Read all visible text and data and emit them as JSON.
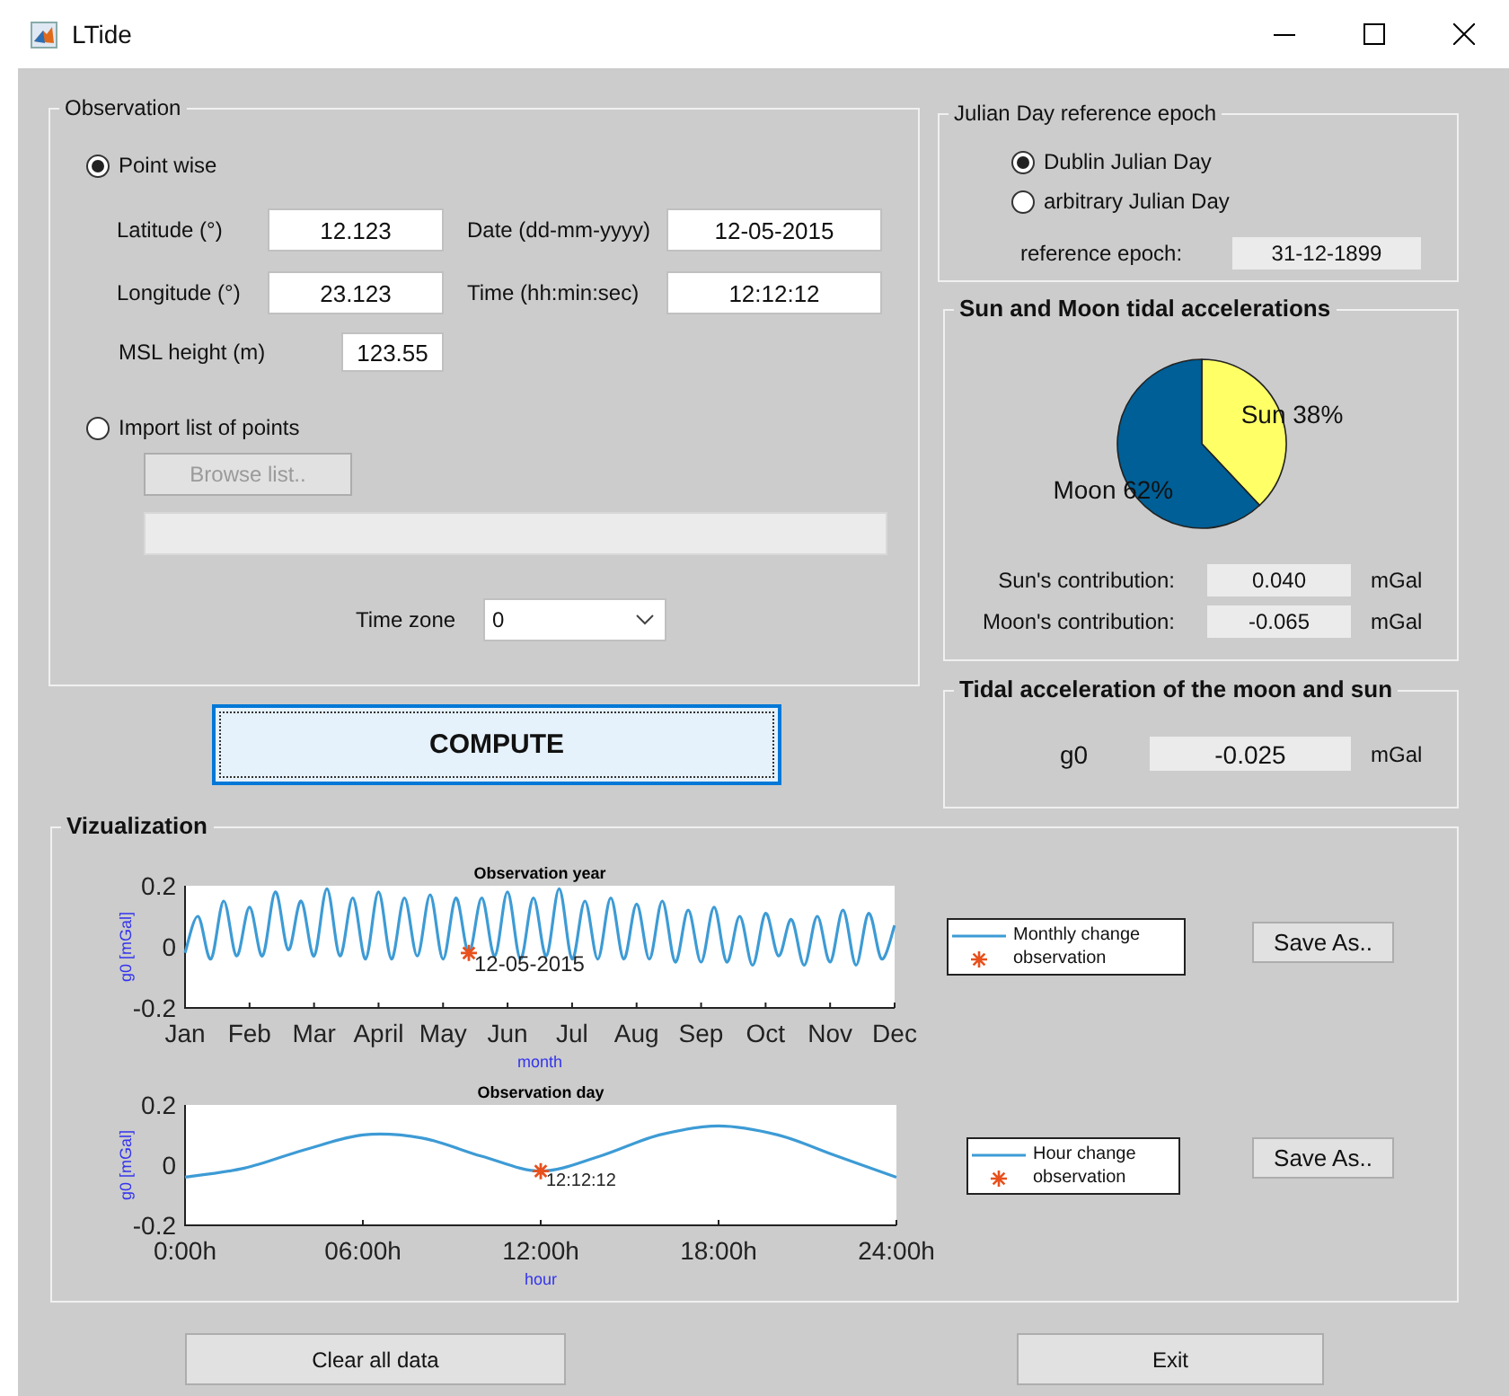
{
  "window": {
    "title": "LTide"
  },
  "observation": {
    "title": "Observation",
    "modes": [
      {
        "label": "Point wise",
        "selected": true
      },
      {
        "label": "Import list of points",
        "selected": false
      }
    ],
    "latitude": {
      "label": "Latitude (°)",
      "value": "12.123"
    },
    "date": {
      "label": "Date (dd-mm-yyyy)",
      "value": "12-05-2015"
    },
    "longitude": {
      "label": "Longitude (°)",
      "value": "23.123"
    },
    "time": {
      "label": "Time (hh:min:sec)",
      "value": "12:12:12"
    },
    "msl_height": {
      "label": "MSL height (m)",
      "value": "123.55"
    },
    "browse_button": {
      "label": "Browse list..",
      "disabled": true
    },
    "time_zone": {
      "label": "Time zone",
      "value": "0"
    }
  },
  "compute_button": {
    "label": "COMPUTE"
  },
  "julian": {
    "title": "Julian Day reference epoch",
    "options": [
      {
        "label": "Dublin Julian Day",
        "selected": true
      },
      {
        "label": "arbitrary Julian Day",
        "selected": false
      }
    ],
    "reference_label": "reference epoch:",
    "reference_value": "31-12-1899"
  },
  "sun_moon": {
    "title": "Sun and Moon tidal accelerations",
    "chart_data": {
      "type": "pie",
      "values": [
        38,
        62
      ],
      "value_labels": [
        "Sun 38%",
        "Moon 62%"
      ]
    },
    "contributions": [
      {
        "label": "Sun's contribution:",
        "value": "0.040",
        "unit": "mGal"
      },
      {
        "label": "Moon's contribution:",
        "value": "-0.065",
        "unit": "mGal"
      }
    ]
  },
  "tidal": {
    "title": "Tidal acceleration of the moon and sun",
    "label": "g0",
    "value": "-0.025",
    "unit": "mGal"
  },
  "visualization": {
    "title": "Vizualization",
    "plots": [
      {
        "chart_data": {
          "type": "line",
          "title": "Observation year",
          "xlabel": "month",
          "ylabel": "g0 [mGal]",
          "ylim": [
            -0.2,
            0.2
          ],
          "yticks": [
            -0.2,
            0,
            0.2
          ],
          "categories": [
            "Jan",
            null,
            null,
            null,
            null,
            "Feb",
            null,
            null,
            null,
            null,
            "Mar",
            null,
            null,
            null,
            null,
            "April",
            null,
            null,
            null,
            null,
            "May",
            null,
            null,
            null,
            null,
            "Jun",
            null,
            null,
            null,
            null,
            "Jul",
            null,
            null,
            null,
            null,
            "Aug",
            null,
            null,
            null,
            null,
            "Sep",
            null,
            null,
            null,
            null,
            "Oct",
            null,
            null,
            null,
            null,
            "Nov",
            null,
            null,
            null,
            null,
            "Dec"
          ],
          "series": [
            {
              "name": "Monthly change",
              "color": "#3d9bd5",
              "values": [
                -0.02,
                0.1,
                -0.04,
                0.15,
                -0.03,
                0.13,
                -0.03,
                0.18,
                -0.01,
                0.15,
                -0.03,
                0.19,
                -0.03,
                0.16,
                -0.04,
                0.18,
                -0.04,
                0.16,
                -0.03,
                0.17,
                -0.04,
                0.16,
                -0.02,
                0.16,
                -0.03,
                0.18,
                -0.04,
                0.16,
                -0.03,
                0.19,
                -0.04,
                0.15,
                -0.04,
                0.16,
                -0.04,
                0.14,
                -0.04,
                0.15,
                -0.05,
                0.12,
                -0.05,
                0.13,
                -0.05,
                0.1,
                -0.06,
                0.11,
                -0.03,
                0.09,
                -0.06,
                0.1,
                -0.05,
                0.12,
                -0.06,
                0.11,
                -0.04,
                0.07
              ]
            },
            {
              "name": "observation",
              "marker": "cross",
              "color": "#e8501c",
              "values": [
                null,
                null,
                null,
                null,
                null,
                null,
                null,
                null,
                null,
                null,
                null,
                null,
                null,
                null,
                null,
                null,
                null,
                null,
                null,
                null,
                null,
                null,
                -0.02,
                null,
                null,
                null,
                null,
                null,
                null,
                null,
                null,
                null,
                null,
                null,
                null,
                null,
                null,
                null,
                null,
                null,
                null,
                null,
                null,
                null,
                null,
                null,
                null,
                null,
                null,
                null,
                null,
                null,
                null,
                null,
                null,
                null
              ]
            }
          ],
          "annotations": [
            {
              "text": "12-05-2015"
            }
          ]
        },
        "save_button": "Save As.."
      },
      {
        "chart_data": {
          "type": "line",
          "title": "Observation day",
          "xlabel": "hour",
          "ylabel": "g0 [mGal]",
          "ylim": [
            -0.2,
            0.2
          ],
          "yticks": [
            -0.2,
            0,
            0.2
          ],
          "categories": [
            "0:00h",
            null,
            null,
            "06:00h",
            null,
            null,
            "12:00h",
            null,
            null,
            "18:00h",
            null,
            null,
            "24:00h"
          ],
          "series": [
            {
              "name": "Hour change",
              "color": "#3d9bd5",
              "values": [
                -0.04,
                -0.01,
                0.05,
                0.1,
                0.09,
                0.03,
                -0.02,
                0.03,
                0.1,
                0.13,
                0.1,
                0.03,
                -0.04
              ]
            },
            {
              "name": "observation",
              "marker": "cross",
              "color": "#e8501c",
              "values": [
                null,
                null,
                null,
                null,
                null,
                null,
                -0.02,
                null,
                null,
                null,
                null,
                null,
                null
              ]
            }
          ],
          "annotations": [
            {
              "text": "12:12:12"
            }
          ]
        },
        "save_button": "Save As.."
      }
    ]
  },
  "buttons": [
    "Clear all data",
    "Exit"
  ]
}
